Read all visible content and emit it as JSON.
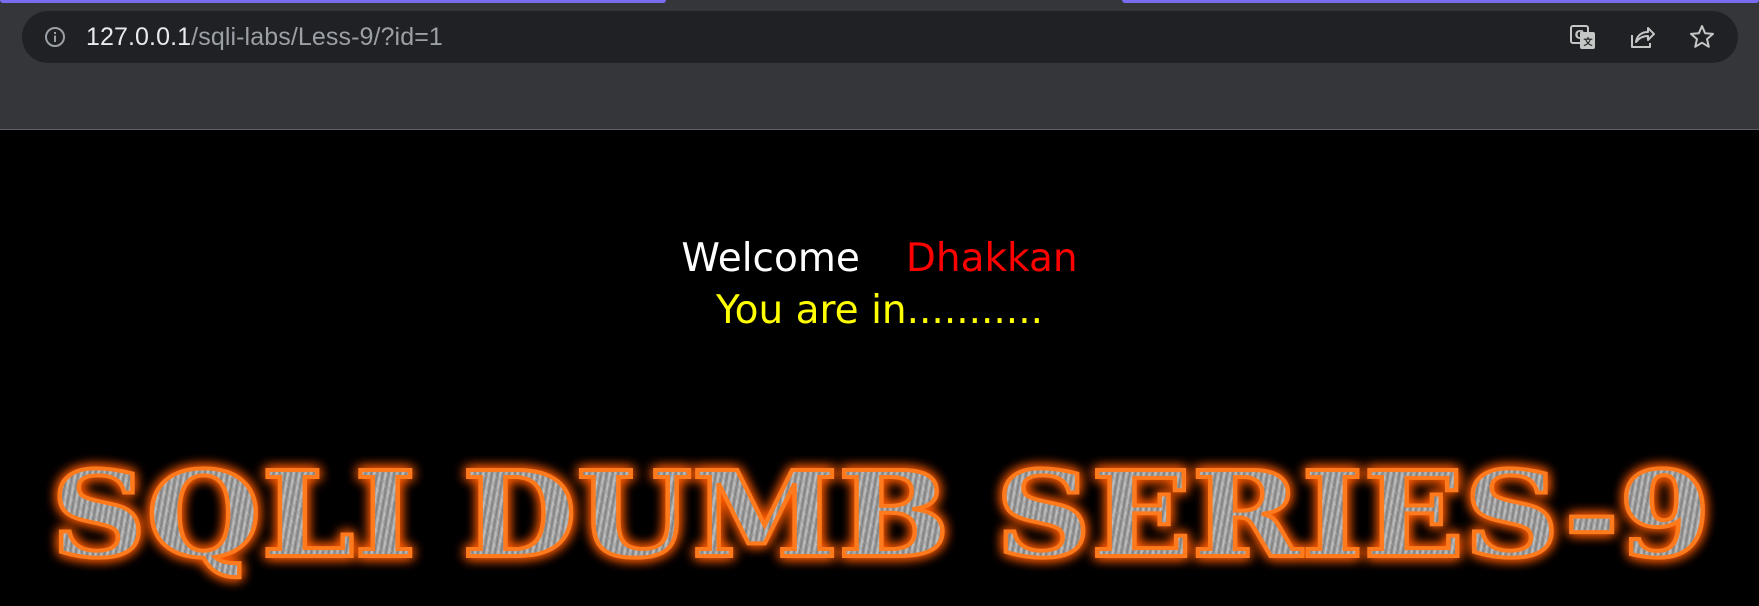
{
  "browser": {
    "address_bar": {
      "host": "127.0.0.1",
      "path": "/sqli-labs/Less-9/?id=1"
    },
    "icons": {
      "site_info": "info-icon",
      "translate": "translate-icon",
      "share": "share-icon",
      "bookmark": "star-icon"
    },
    "colors": {
      "chrome": "#35363a",
      "omnibox": "#202124",
      "tab_accent": "#7a6cf0"
    }
  },
  "page": {
    "welcome_label": "Welcome",
    "user_name": "Dhakkan",
    "status_message": "You are in...........",
    "banner_text": "SQLI DUMB SERIES-9",
    "colors": {
      "background": "#000000",
      "welcome": "#ffffff",
      "user_name": "#ff0000",
      "status": "#ffff00",
      "banner_glow": "#ff5a00"
    }
  }
}
